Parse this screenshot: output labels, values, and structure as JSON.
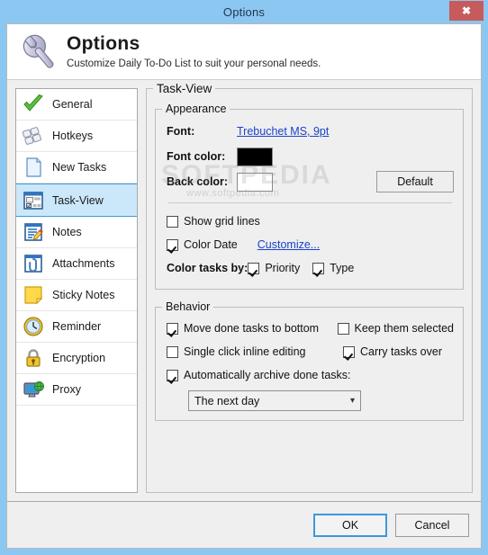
{
  "window": {
    "title": "Options",
    "close_label": "✖"
  },
  "header": {
    "icon": "wrench-icon",
    "title": "Options",
    "subtitle": "Customize Daily To-Do List to suit your personal needs."
  },
  "sidebar": {
    "items": [
      {
        "label": "General",
        "icon": "green-check-icon",
        "selected": false
      },
      {
        "label": "Hotkeys",
        "icon": "keyboard-keys-icon",
        "selected": false
      },
      {
        "label": "New Tasks",
        "icon": "blank-page-icon",
        "selected": false
      },
      {
        "label": "Task-View",
        "icon": "window-panes-icon",
        "selected": true
      },
      {
        "label": "Notes",
        "icon": "note-pencil-icon",
        "selected": false
      },
      {
        "label": "Attachments",
        "icon": "paperclip-icon",
        "selected": false
      },
      {
        "label": "Sticky Notes",
        "icon": "sticky-note-icon",
        "selected": false
      },
      {
        "label": "Reminder",
        "icon": "clock-icon",
        "selected": false
      },
      {
        "label": "Encryption",
        "icon": "padlock-icon",
        "selected": false
      },
      {
        "label": "Proxy",
        "icon": "monitor-globe-icon",
        "selected": false
      }
    ]
  },
  "main": {
    "group_title": "Task-View",
    "appearance": {
      "legend": "Appearance",
      "font_label": "Font:",
      "font_value": "Trebuchet MS, 9pt",
      "font_color_label": "Font color:",
      "font_color_value": "#000000",
      "back_color_label": "Back color:",
      "back_color_value": "#ffffff",
      "default_button": "Default",
      "show_grid_lines": {
        "label": "Show grid lines",
        "checked": false
      },
      "color_date": {
        "label": "Color Date",
        "checked": true
      },
      "customize_link": "Customize...",
      "color_tasks_by_label": "Color tasks by:",
      "color_by_priority": {
        "label": "Priority",
        "checked": true
      },
      "color_by_type": {
        "label": "Type",
        "checked": true
      }
    },
    "behavior": {
      "legend": "Behavior",
      "move_done_bottom": {
        "label": "Move done tasks to bottom",
        "checked": true
      },
      "keep_them_selected": {
        "label": "Keep them selected",
        "checked": false
      },
      "single_click_editing": {
        "label": "Single click inline editing",
        "checked": false
      },
      "carry_tasks_over": {
        "label": "Carry tasks over",
        "checked": true
      },
      "auto_archive": {
        "label": "Automatically archive done tasks:",
        "checked": true
      },
      "archive_when_value": "The next day",
      "archive_when_options": [
        "The next day"
      ]
    }
  },
  "watermark": {
    "brand": "SOFTPEDIA",
    "url": "www.softpedia.com"
  },
  "footer": {
    "ok_label": "OK",
    "cancel_label": "Cancel"
  },
  "colors": {
    "titlebar": "#8cc7f2",
    "close": "#c75b5b",
    "accent": "#3a9ad9",
    "link": "#1b43c8",
    "selection": "#cbe8fb"
  }
}
